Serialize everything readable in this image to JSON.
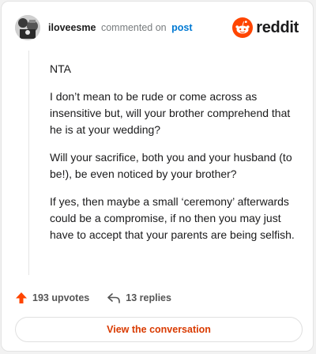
{
  "comment": {
    "username": "iloveesme",
    "action_text": "commented on",
    "post_link_label": "post",
    "paragraphs": [
      "NTA",
      "I don’t mean to be rude or come across as insensitive but, will your brother comprehend that he is at your wedding?",
      "Will your sacrifice, both you and your husband (to be!), be even noticed by your brother?",
      "If yes, then maybe a small ‘ceremony’ afterwards could be a compromise, if no then you may just have to accept that your parents are being selfish."
    ]
  },
  "brand": {
    "name": "reddit",
    "accent": "#ff4500"
  },
  "stats": {
    "upvotes": "193 upvotes",
    "replies": "13 replies"
  },
  "cta": {
    "label": "View the conversation",
    "color": "#d93a00"
  },
  "icons": [
    "avatar",
    "reddit-logo-icon",
    "upvote-arrow-icon",
    "reply-arrow-icon"
  ]
}
